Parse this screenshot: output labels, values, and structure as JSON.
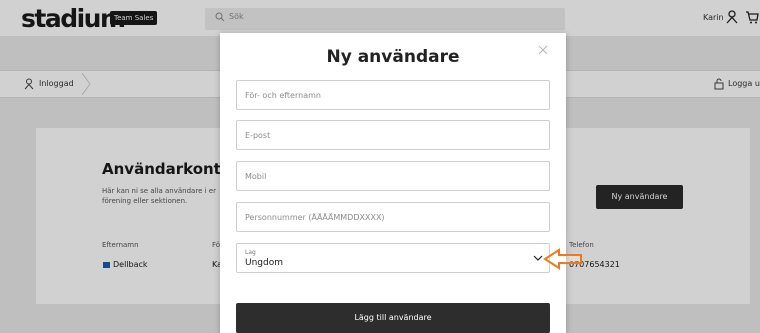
{
  "header": {
    "logo": "stadium",
    "logo_badge": "Team Sales",
    "search_placeholder": "Sök",
    "user_name": "Karin"
  },
  "breadcrumb": {
    "item": "Inloggad",
    "logout": "Logga ut"
  },
  "page": {
    "title": "Användarkontroll",
    "description": "Här kan ni se alla användare i er förening eller sektionen.",
    "new_user_button": "Ny användare",
    "columns": {
      "lastname": "Efternamn",
      "firstname": "Förnamn",
      "phone": "Telefon"
    },
    "rows": [
      {
        "lastname": "Dellback",
        "firstname": "Karin",
        "phone": "0707654321"
      }
    ]
  },
  "modal": {
    "title": "Ny användare",
    "fields": {
      "name_placeholder": "För- och efternamn",
      "email_placeholder": "E-post",
      "mobile_placeholder": "Mobil",
      "personnummer_placeholder": "Personnummer (ÅÅÅÅMMDDXXXX)"
    },
    "team_select": {
      "label": "Lag",
      "value": "Ungdom"
    },
    "submit_button": "Lägg till användare"
  },
  "colors": {
    "accent_arrow": "#f07a1a",
    "button_dark": "#2d2d2d"
  }
}
